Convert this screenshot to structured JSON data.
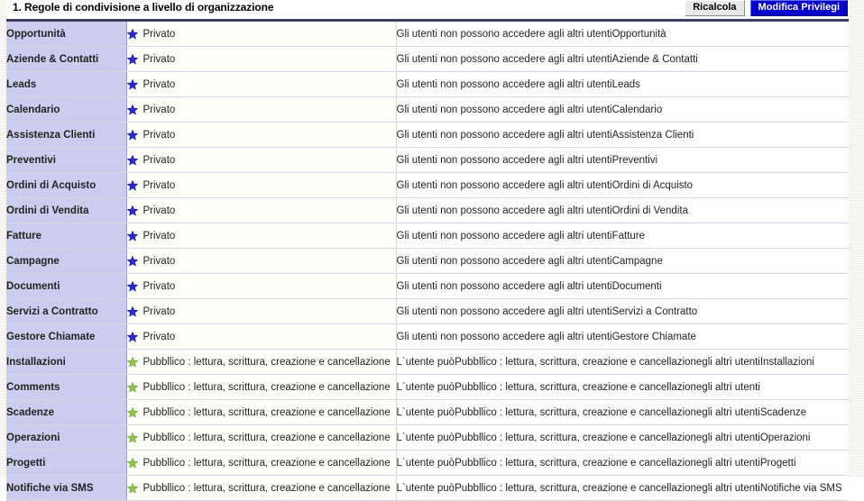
{
  "header": {
    "title": "1. Regole di condivisione a livello di organizzazione",
    "recalc_label": "Ricalcola",
    "edit_label": "Modifica Privilegi"
  },
  "colors": {
    "primary_button_bg": "#0000cc",
    "secondary_button_bg": "#e8e8e8",
    "module_column_bg": "#ccccee",
    "table_top_border": "#3d3d63",
    "private_star": "#2b2bd4",
    "public_star": "#8ec64a"
  },
  "icons": {
    "private": "star-icon-blue",
    "public": "star-icon-green"
  },
  "rules": {
    "private_label": "Privato",
    "public_label": "Pubbllico : lettura, scrittura, creazione e cancellazione",
    "private_desc_prefix": "Gli utenti non possono accedere agli altri utenti",
    "public_desc_prefix": "L`utente puòPubbllico : lettura, scrittura, creazione e cancellazionegli altri utenti"
  },
  "rows": [
    {
      "module": "Opportunità",
      "access": "private",
      "rule": "Privato",
      "description": "Gli utenti non possono accedere agli altri utentiOpportunità"
    },
    {
      "module": "Aziende & Contatti",
      "access": "private",
      "rule": "Privato",
      "description": "Gli utenti non possono accedere agli altri utentiAziende & Contatti"
    },
    {
      "module": "Leads",
      "access": "private",
      "rule": "Privato",
      "description": "Gli utenti non possono accedere agli altri utentiLeads"
    },
    {
      "module": "Calendario",
      "access": "private",
      "rule": "Privato",
      "description": "Gli utenti non possono accedere agli altri utentiCalendario"
    },
    {
      "module": "Assistenza Clienti",
      "access": "private",
      "rule": "Privato",
      "description": "Gli utenti non possono accedere agli altri utentiAssistenza Clienti"
    },
    {
      "module": "Preventivi",
      "access": "private",
      "rule": "Privato",
      "description": "Gli utenti non possono accedere agli altri utentiPreventivi"
    },
    {
      "module": "Ordini di Acquisto",
      "access": "private",
      "rule": "Privato",
      "description": "Gli utenti non possono accedere agli altri utentiOrdini di Acquisto"
    },
    {
      "module": "Ordini di Vendita",
      "access": "private",
      "rule": "Privato",
      "description": "Gli utenti non possono accedere agli altri utentiOrdini di Vendita"
    },
    {
      "module": "Fatture",
      "access": "private",
      "rule": "Privato",
      "description": "Gli utenti non possono accedere agli altri utentiFatture"
    },
    {
      "module": "Campagne",
      "access": "private",
      "rule": "Privato",
      "description": "Gli utenti non possono accedere agli altri utentiCampagne"
    },
    {
      "module": "Documenti",
      "access": "private",
      "rule": "Privato",
      "description": "Gli utenti non possono accedere agli altri utentiDocumenti"
    },
    {
      "module": "Servizi a Contratto",
      "access": "private",
      "rule": "Privato",
      "description": "Gli utenti non possono accedere agli altri utentiServizi a Contratto"
    },
    {
      "module": "Gestore Chiamate",
      "access": "private",
      "rule": "Privato",
      "description": "Gli utenti non possono accedere agli altri utentiGestore Chiamate"
    },
    {
      "module": "Installazioni",
      "access": "public",
      "rule": "Pubbllico : lettura, scrittura, creazione e cancellazione",
      "description": "L`utente puòPubbllico : lettura, scrittura, creazione e cancellazionegli altri utentiInstallazioni"
    },
    {
      "module": "Comments",
      "access": "public",
      "rule": "Pubbllico : lettura, scrittura, creazione e cancellazione",
      "description": "L`utente puòPubbllico : lettura, scrittura, creazione e cancellazionegli altri utenti"
    },
    {
      "module": "Scadenze",
      "access": "public",
      "rule": "Pubbllico : lettura, scrittura, creazione e cancellazione",
      "description": "L`utente puòPubbllico : lettura, scrittura, creazione e cancellazionegli altri utentiScadenze"
    },
    {
      "module": "Operazioni",
      "access": "public",
      "rule": "Pubbllico : lettura, scrittura, creazione e cancellazione",
      "description": "L`utente puòPubbllico : lettura, scrittura, creazione e cancellazionegli altri utentiOperazioni"
    },
    {
      "module": "Progetti",
      "access": "public",
      "rule": "Pubbllico : lettura, scrittura, creazione e cancellazione",
      "description": "L`utente puòPubbllico : lettura, scrittura, creazione e cancellazionegli altri utentiProgetti"
    },
    {
      "module": "Notifiche via SMS",
      "access": "public",
      "rule": "Pubbllico : lettura, scrittura, creazione e cancellazione",
      "description": "L`utente puòPubbllico : lettura, scrittura, creazione e cancellazionegli altri utentiNotifiche via SMS"
    }
  ]
}
